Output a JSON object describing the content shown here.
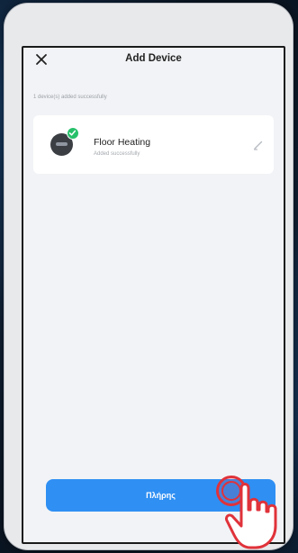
{
  "nav": {
    "title": "Add Device",
    "close_icon": "close-icon"
  },
  "hint": "1 device(s) added successfully",
  "device": {
    "name": "Floor Heating",
    "status": "Added successfully",
    "icon": "thermostat-icon",
    "badge_icon": "check-icon",
    "edit_icon": "pencil-icon"
  },
  "done_button": {
    "label": "Πλήρης"
  },
  "overlay": {
    "pointer_icon": "tap-hand-icon"
  },
  "colors": {
    "accent": "#2f8ff3",
    "success": "#27c06a",
    "highlight": "#e0323a",
    "screen_bg": "#f2f3f6"
  }
}
